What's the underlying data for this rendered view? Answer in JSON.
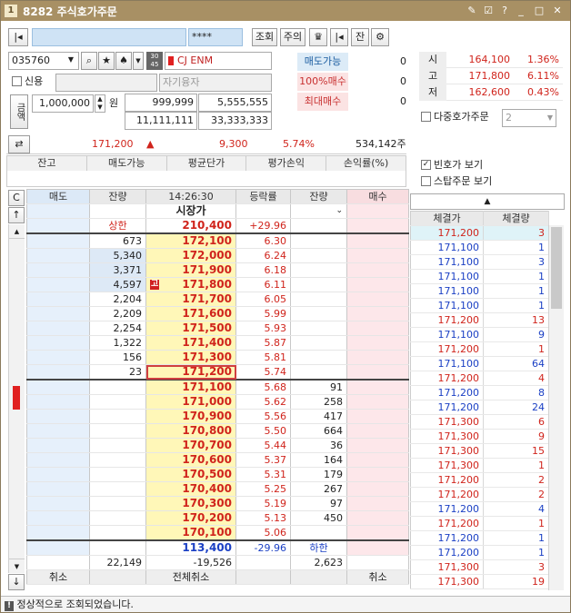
{
  "title": {
    "num": "1",
    "text": "8282 주식호가주문"
  },
  "toolbar": {
    "password": "****",
    "buttons": [
      "조회",
      "주의",
      "♛",
      "|◂",
      "잔",
      "⚙"
    ]
  },
  "stock": {
    "code": "035760",
    "badge": "30 45",
    "name": "CJ ENM",
    "credit_label": "신용",
    "self_funds": "자기융자",
    "amount_label": "금액",
    "qty": "1,000,000",
    "won": "원",
    "v1": "999,999",
    "v2": "5,555,555",
    "v3": "11,111,111",
    "v4": "33,333,333"
  },
  "sellable": {
    "items": [
      {
        "label": "매도가능",
        "value": "0"
      },
      {
        "label": "100%매수",
        "value": "0"
      },
      {
        "label": "최대매수",
        "value": "0"
      }
    ]
  },
  "ohl": {
    "rows": [
      {
        "label": "시",
        "price": "164,100",
        "pct": "1.36%"
      },
      {
        "label": "고",
        "price": "171,800",
        "pct": "6.11%"
      },
      {
        "label": "저",
        "price": "162,600",
        "pct": "0.43%"
      }
    ]
  },
  "multi_order": {
    "label": "다중호가주문",
    "value": "2"
  },
  "quote": {
    "price": "171,200",
    "arrow": "▲",
    "change": "9,300",
    "pct": "5.74%",
    "volume": "534,142주"
  },
  "balance_headers": [
    "잔고",
    "매도가능",
    "평균단가",
    "평가손익",
    "손익률(%)"
  ],
  "options": {
    "empty_quote": "빈호가 보기",
    "stop_order": "스탑주문 보기"
  },
  "hoga": {
    "headers": [
      "매도",
      "잔량",
      "14:26:30",
      "등락률",
      "잔량",
      "매수"
    ],
    "market_price": "시장가",
    "upper_label": "상한",
    "upper_price": "210,400",
    "upper_pct": "+29.96",
    "sell": [
      {
        "qty": "673",
        "price": "172,100",
        "pct": "6.30"
      },
      {
        "qty": "5,340",
        "price": "172,000",
        "pct": "6.24"
      },
      {
        "qty": "3,371",
        "price": "171,900",
        "pct": "6.18"
      },
      {
        "qty": "4,597",
        "price": "171,800",
        "pct": "6.11",
        "tag": "고"
      },
      {
        "qty": "2,204",
        "price": "171,700",
        "pct": "6.05"
      },
      {
        "qty": "2,209",
        "price": "171,600",
        "pct": "5.99"
      },
      {
        "qty": "2,254",
        "price": "171,500",
        "pct": "5.93"
      },
      {
        "qty": "1,322",
        "price": "171,400",
        "pct": "5.87"
      },
      {
        "qty": "156",
        "price": "171,300",
        "pct": "5.81"
      },
      {
        "qty": "23",
        "price": "171,200",
        "pct": "5.74"
      }
    ],
    "buy": [
      {
        "price": "171,100",
        "pct": "5.68",
        "qty": "91"
      },
      {
        "price": "171,000",
        "pct": "5.62",
        "qty": "258"
      },
      {
        "price": "170,900",
        "pct": "5.56",
        "qty": "417"
      },
      {
        "price": "170,800",
        "pct": "5.50",
        "qty": "664"
      },
      {
        "price": "170,700",
        "pct": "5.44",
        "qty": "36"
      },
      {
        "price": "170,600",
        "pct": "5.37",
        "qty": "164"
      },
      {
        "price": "170,500",
        "pct": "5.31",
        "qty": "179"
      },
      {
        "price": "170,400",
        "pct": "5.25",
        "qty": "267"
      },
      {
        "price": "170,300",
        "pct": "5.19",
        "qty": "97"
      },
      {
        "price": "170,200",
        "pct": "5.13",
        "qty": "450"
      },
      {
        "price": "170,100",
        "pct": "5.06",
        "qty": ""
      }
    ],
    "lower_price": "113,400",
    "lower_pct": "-29.96",
    "lower_label": "하한",
    "total_sell": "22,149",
    "total_diff": "-19,526",
    "total_buy": "2,623",
    "cancel": "취소",
    "cancel_all": "전체취소",
    "cancel2": "취소"
  },
  "fills": {
    "headers": [
      "체결가",
      "체결량"
    ],
    "rows": [
      {
        "p": "171,200",
        "q": "3",
        "c": "red"
      },
      {
        "p": "171,100",
        "q": "1",
        "c": "blue"
      },
      {
        "p": "171,100",
        "q": "3",
        "c": "blue"
      },
      {
        "p": "171,100",
        "q": "1",
        "c": "blue"
      },
      {
        "p": "171,100",
        "q": "1",
        "c": "blue"
      },
      {
        "p": "171,100",
        "q": "1",
        "c": "blue"
      },
      {
        "p": "171,200",
        "q": "13",
        "c": "red"
      },
      {
        "p": "171,100",
        "q": "9",
        "c": "blue"
      },
      {
        "p": "171,200",
        "q": "1",
        "c": "red"
      },
      {
        "p": "171,100",
        "q": "64",
        "c": "blue"
      },
      {
        "p": "171,200",
        "q": "4",
        "c": "red"
      },
      {
        "p": "171,200",
        "q": "8",
        "c": "blue"
      },
      {
        "p": "171,200",
        "q": "24",
        "c": "blue"
      },
      {
        "p": "171,300",
        "q": "6",
        "c": "red"
      },
      {
        "p": "171,300",
        "q": "9",
        "c": "red"
      },
      {
        "p": "171,300",
        "q": "15",
        "c": "red"
      },
      {
        "p": "171,300",
        "q": "1",
        "c": "red"
      },
      {
        "p": "171,200",
        "q": "2",
        "c": "red"
      },
      {
        "p": "171,200",
        "q": "2",
        "c": "red"
      },
      {
        "p": "171,200",
        "q": "4",
        "c": "blue"
      },
      {
        "p": "171,200",
        "q": "1",
        "c": "red"
      },
      {
        "p": "171,200",
        "q": "1",
        "c": "blue"
      },
      {
        "p": "171,200",
        "q": "1",
        "c": "blue"
      },
      {
        "p": "171,300",
        "q": "3",
        "c": "red"
      },
      {
        "p": "171,300",
        "q": "19",
        "c": "red"
      }
    ]
  },
  "status": "정상적으로 조회되었습니다."
}
